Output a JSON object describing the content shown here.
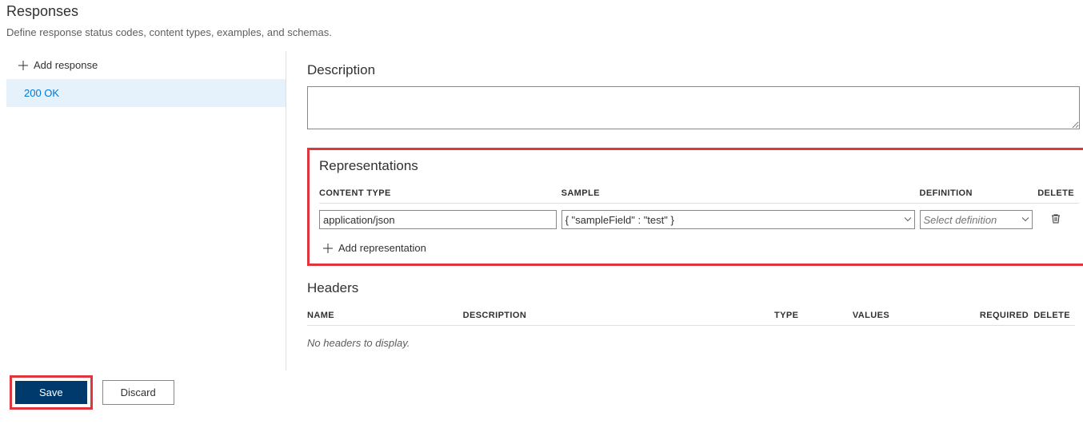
{
  "title": "Responses",
  "subtitle": "Define response status codes, content types, examples, and schemas.",
  "left": {
    "add_response_label": "Add response",
    "items": [
      {
        "label": "200 OK"
      }
    ]
  },
  "description": {
    "title": "Description",
    "value": ""
  },
  "representations": {
    "title": "Representations",
    "columns": {
      "content_type": "CONTENT TYPE",
      "sample": "SAMPLE",
      "definition": "DEFINITION",
      "delete": "DELETE"
    },
    "rows": [
      {
        "content_type": "application/json",
        "sample": "{ \"sampleField\" : \"test\" }",
        "definition_placeholder": "Select definition"
      }
    ],
    "add_label": "Add representation"
  },
  "headers": {
    "title": "Headers",
    "columns": {
      "name": "NAME",
      "description": "DESCRIPTION",
      "type": "TYPE",
      "values": "VALUES",
      "required": "REQUIRED",
      "delete": "DELETE"
    },
    "empty": "No headers to display."
  },
  "footer": {
    "save": "Save",
    "discard": "Discard"
  }
}
